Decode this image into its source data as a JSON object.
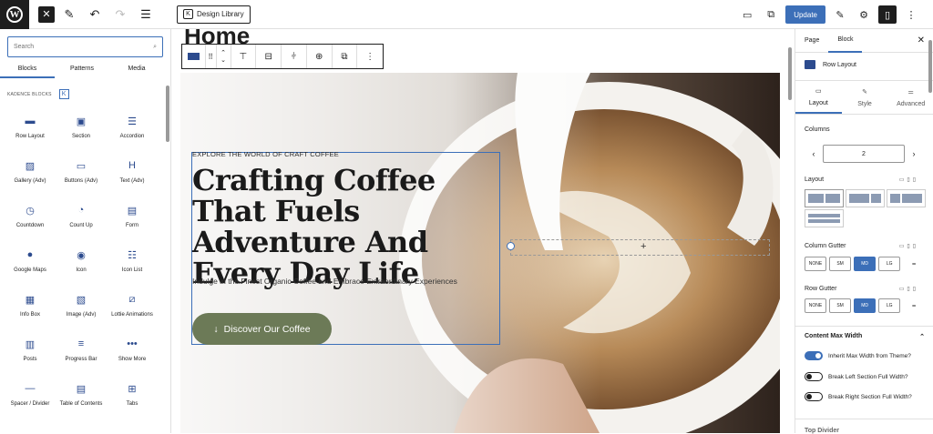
{
  "topbar": {
    "design_library": "Design Library",
    "update": "Update"
  },
  "left": {
    "search_placeholder": "Search",
    "tabs": [
      "Blocks",
      "Patterns",
      "Media"
    ],
    "category": "KADENCE BLOCKS",
    "blocks": [
      {
        "label": "Row Layout",
        "icon": "row-layout-icon"
      },
      {
        "label": "Section",
        "icon": "section-icon"
      },
      {
        "label": "Accordion",
        "icon": "accordion-icon"
      },
      {
        "label": "Gallery (Adv)",
        "icon": "gallery-icon"
      },
      {
        "label": "Buttons (Adv)",
        "icon": "buttons-icon"
      },
      {
        "label": "Text (Adv)",
        "icon": "heading-icon"
      },
      {
        "label": "Countdown",
        "icon": "countdown-icon"
      },
      {
        "label": "Count Up",
        "icon": "count-up-icon"
      },
      {
        "label": "Form",
        "icon": "form-icon"
      },
      {
        "label": "Google Maps",
        "icon": "map-pin-icon"
      },
      {
        "label": "Icon",
        "icon": "icon-icon"
      },
      {
        "label": "Icon List",
        "icon": "icon-list-icon"
      },
      {
        "label": "Info Box",
        "icon": "info-box-icon"
      },
      {
        "label": "Image (Adv)",
        "icon": "image-icon"
      },
      {
        "label": "Lottie Animations",
        "icon": "lottie-icon"
      },
      {
        "label": "Posts",
        "icon": "posts-icon"
      },
      {
        "label": "Progress Bar",
        "icon": "progress-bar-icon"
      },
      {
        "label": "Show More",
        "icon": "show-more-icon"
      },
      {
        "label": "Spacer / Divider",
        "icon": "spacer-icon"
      },
      {
        "label": "Table of Contents",
        "icon": "table-of-contents-icon"
      },
      {
        "label": "Tabs",
        "icon": "tabs-icon"
      }
    ]
  },
  "canvas": {
    "page_title": "Home",
    "hero": {
      "eyebrow": "EXPLORE THE WORLD OF CRAFT COFFEE",
      "headline": "Crafting Coffee That Fuels Adventure And Every Day Life",
      "subtext": "Indulge in the Finest Organic Coffee and Embrace Extraordinary Experiences",
      "cta": "Discover Our Coffee",
      "cta_arrow": "↓"
    }
  },
  "right": {
    "tabs": [
      "Page",
      "Block"
    ],
    "block_name": "Row Layout",
    "sub_tabs": [
      "Layout",
      "Style",
      "Advanced"
    ],
    "columns_label": "Columns",
    "columns_value": "2",
    "layout_label": "Layout",
    "column_gutter_label": "Column Gutter",
    "row_gutter_label": "Row Gutter",
    "gutter_options": [
      "NONE",
      "SM",
      "MD",
      "LG"
    ],
    "gutter_selected": "MD",
    "content_max_width": "Content Max Width",
    "toggles": [
      {
        "label": "Inherit Max Width from Theme?",
        "on": true
      },
      {
        "label": "Break Left Section Full Width?",
        "on": false
      },
      {
        "label": "Break Right Section Full Width?",
        "on": false
      }
    ],
    "next_section": "Top Divider"
  },
  "colors": {
    "accent": "#3c6fb8",
    "cta_bg": "#6c7a57",
    "dark": "#1e1e1e"
  }
}
